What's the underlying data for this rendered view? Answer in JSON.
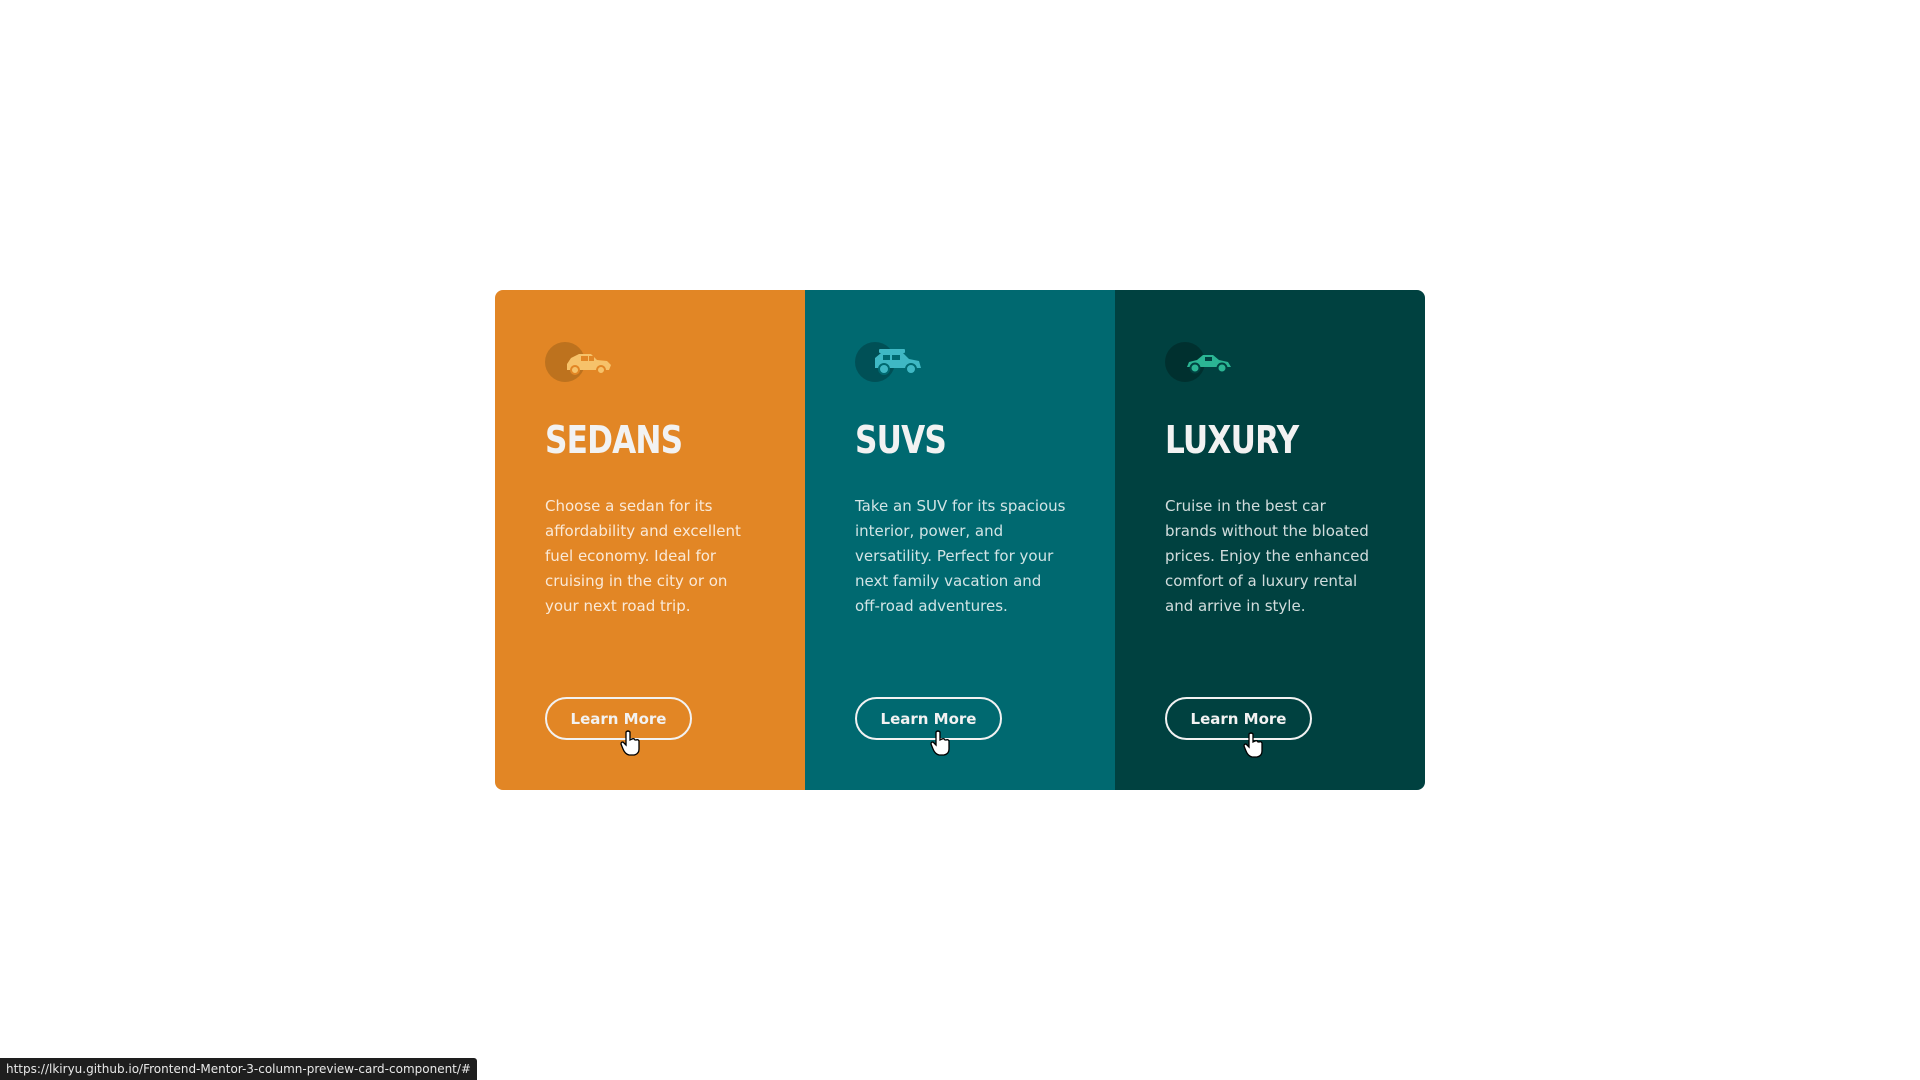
{
  "cards": [
    {
      "title": "SEDANS",
      "description": "Choose a sedan for its affordability and excellent fuel economy. Ideal for cruising in the city or on your next road trip.",
      "button_label": "Learn More",
      "icon": "sedan-car-icon",
      "background_color": "#e28625"
    },
    {
      "title": "SUVS",
      "description": "Take an SUV for its spacious interior, power, and versatility. Perfect for your next family vacation and off-road adventures.",
      "button_label": "Learn More",
      "icon": "suv-car-icon",
      "background_color": "#006970"
    },
    {
      "title": "LUXURY",
      "description": "Cruise in the best car brands without the bloated prices. Enjoy the enhanced comfort of a luxury rental and arrive in style.",
      "button_label": "Learn More",
      "icon": "luxury-car-icon",
      "background_color": "#004140"
    }
  ],
  "status_bar": {
    "url": "https://lkiryu.github.io/Frontend-Mentor-3-column-preview-card-component/#"
  },
  "colors": {
    "sedans_accent": "#f6c26a",
    "suvs_accent": "#3fb8c4",
    "luxury_accent": "#2bb594"
  }
}
